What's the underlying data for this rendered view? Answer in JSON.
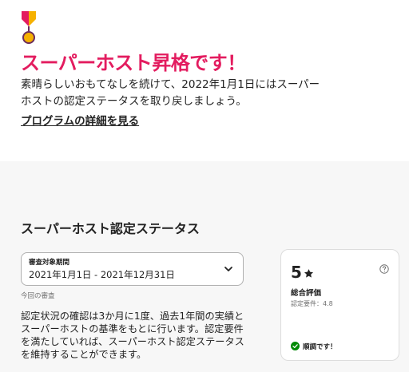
{
  "colors": {
    "accent": "#e31c5f",
    "text": "#222222",
    "muted": "#717171",
    "success": "#008a05",
    "section_bg": "#f7f7f7"
  },
  "promotion": {
    "badge_icon": "superhost-medal-icon",
    "headline": "スーパーホスト昇格です！",
    "message": "素晴らしいおもてなしを続けて、2022年1月1日にはスーパーホストの認定ステータスを取り戻しましょう。",
    "link_label": "プログラムの詳細を見る"
  },
  "status_section": {
    "title": "スーパーホスト認定ステータス",
    "period_select": {
      "label": "審査対象期間",
      "value": "2021年1月1日 - 2021年12月31日",
      "icon": "chevron-down-icon"
    },
    "review_note": "今回の審査",
    "description": "認定状況の確認は3か月に1度、過去1年間の実績とスーパーホストの基準をもとに行います。認定要件を満たしていれば、スーパーホスト認定ステータスを維持することができます。"
  },
  "rating_card": {
    "value": "5",
    "star_icon": "star-icon",
    "help_icon": "help-icon",
    "label": "総合評価",
    "requirement": "認定要件：4.8",
    "status_icon": "check-circle-icon",
    "status": "順調です！"
  }
}
